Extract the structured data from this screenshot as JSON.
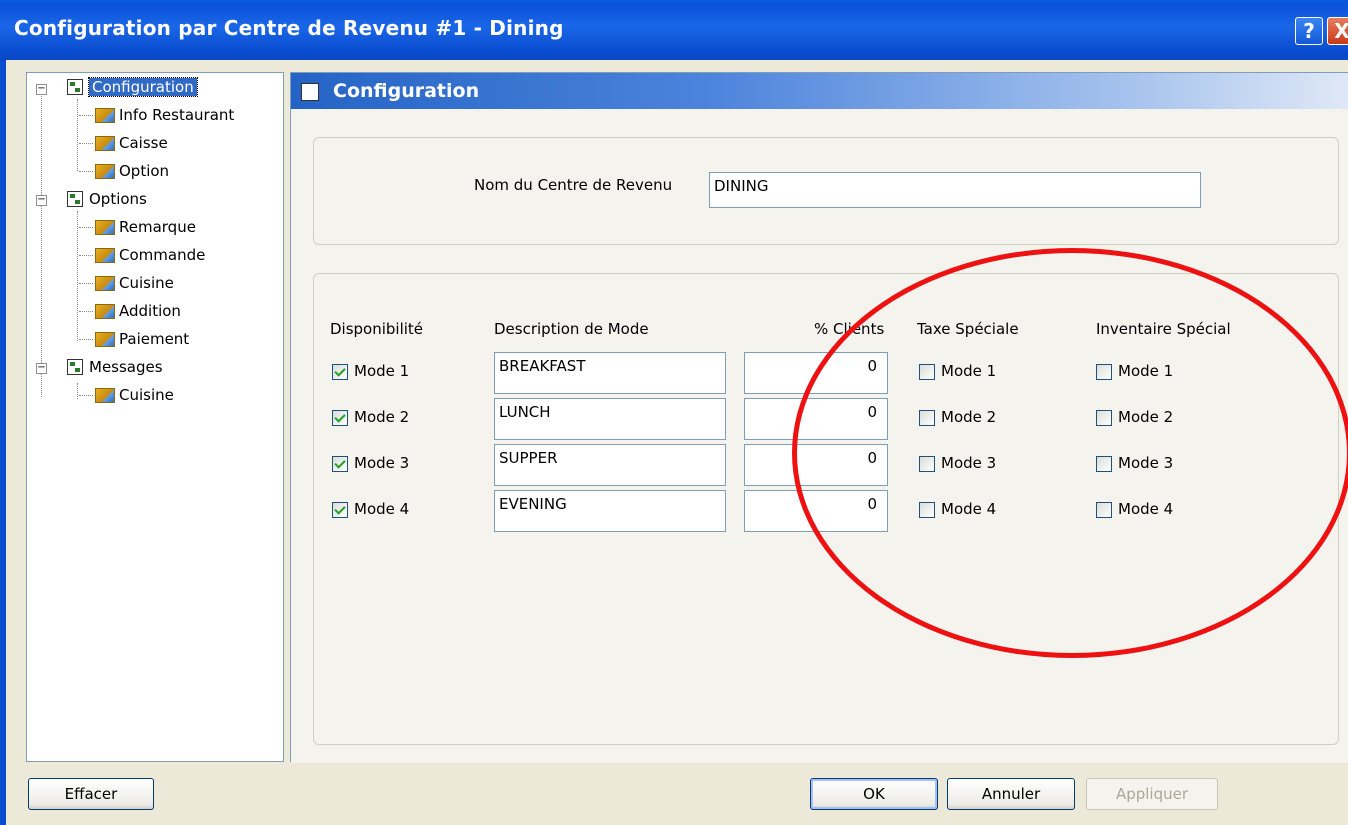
{
  "window": {
    "title": "Configuration par Centre de Revenu #1 - Dining",
    "help_glyph": "?",
    "close_glyph": "X"
  },
  "tree": {
    "items": [
      {
        "label": "Configuration"
      },
      {
        "label": "Info Restaurant"
      },
      {
        "label": "Caisse"
      },
      {
        "label": "Option"
      },
      {
        "label": "Options"
      },
      {
        "label": "Remarque"
      },
      {
        "label": "Commande"
      },
      {
        "label": "Cuisine"
      },
      {
        "label": "Addition"
      },
      {
        "label": "Paiement"
      },
      {
        "label": "Messages"
      },
      {
        "label": "Cuisine"
      }
    ],
    "expander_glyph": "−"
  },
  "panel": {
    "title": "Configuration",
    "name_label": "Nom du Centre de Revenu",
    "name_value": "DINING",
    "headers": {
      "availability": "Disponibilité",
      "description": "Description de Mode",
      "clients": "% Clients",
      "special_tax": "Taxe Spéciale",
      "special_inventory": "Inventaire Spécial"
    },
    "rows": [
      {
        "mode": "Mode 1",
        "available": true,
        "description": "BREAKFAST",
        "clients": "0",
        "tax": false,
        "inventory": false
      },
      {
        "mode": "Mode 2",
        "available": true,
        "description": "LUNCH",
        "clients": "0",
        "tax": false,
        "inventory": false
      },
      {
        "mode": "Mode 3",
        "available": true,
        "description": "SUPPER",
        "clients": "0",
        "tax": false,
        "inventory": false
      },
      {
        "mode": "Mode 4",
        "available": true,
        "description": "EVENING",
        "clients": "0",
        "tax": false,
        "inventory": false
      }
    ]
  },
  "buttons": {
    "clear": "Effacer",
    "ok": "OK",
    "cancel": "Annuler",
    "apply": "Appliquer"
  },
  "colors": {
    "title_bar": "#0a52d8",
    "selection": "#316ac5",
    "annotation_circle": "#ee1111",
    "checkmark": "#21a121"
  }
}
